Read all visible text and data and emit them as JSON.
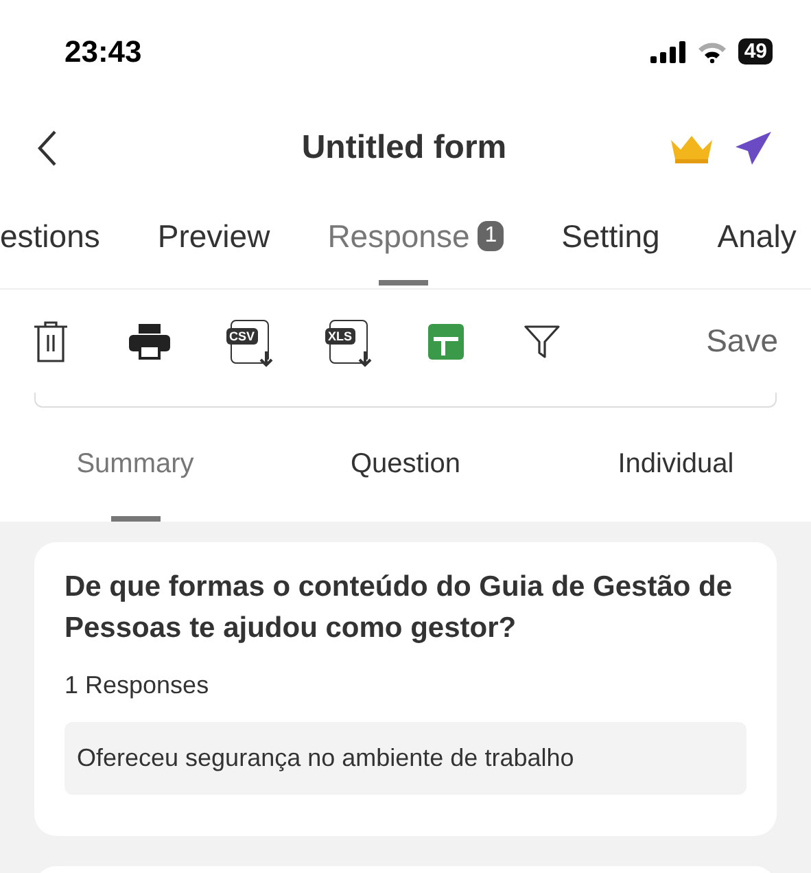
{
  "status_bar": {
    "time": "23:43",
    "battery": "49"
  },
  "header": {
    "title": "Untitled form"
  },
  "tabs": [
    {
      "label": "estions",
      "selected": false
    },
    {
      "label": "Preview",
      "selected": false
    },
    {
      "label": "Response",
      "selected": true,
      "badge": "1"
    },
    {
      "label": "Setting",
      "selected": false
    },
    {
      "label": "Analy",
      "selected": false
    }
  ],
  "toolbar": {
    "tools": [
      {
        "kind": "trash"
      },
      {
        "kind": "print"
      },
      {
        "kind": "export",
        "label": "CSV"
      },
      {
        "kind": "export",
        "label": "XLS"
      },
      {
        "kind": "sheet"
      },
      {
        "kind": "filter"
      }
    ],
    "save": "Save"
  },
  "sub_tabs": [
    {
      "label": "Summary",
      "selected": true
    },
    {
      "label": "Question",
      "selected": false
    },
    {
      "label": "Individual",
      "selected": false
    }
  ],
  "cards": [
    {
      "question": "De que formas o conteúdo do Guia de Gestão de Pessoas te ajudou como gestor?",
      "count": "1 Responses",
      "answers": [
        "Ofereceu segurança no ambiente de trabalho"
      ]
    }
  ]
}
